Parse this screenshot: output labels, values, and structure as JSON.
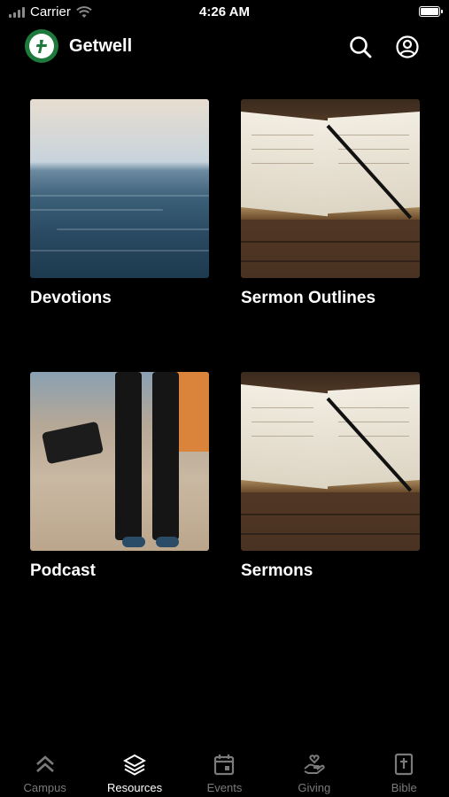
{
  "status_bar": {
    "carrier": "Carrier",
    "time": "4:26 AM"
  },
  "header": {
    "title": "Getwell"
  },
  "resources": [
    {
      "label": "Devotions"
    },
    {
      "label": "Sermon Outlines"
    },
    {
      "label": "Podcast"
    },
    {
      "label": "Sermons"
    }
  ],
  "tabs": [
    {
      "label": "Campus",
      "icon": "chevrons-up-icon"
    },
    {
      "label": "Resources",
      "icon": "stack-layers-icon",
      "active": true
    },
    {
      "label": "Events",
      "icon": "calendar-icon"
    },
    {
      "label": "Giving",
      "icon": "hand-heart-icon"
    },
    {
      "label": "Bible",
      "icon": "bible-icon"
    }
  ],
  "colors": {
    "background": "#000000",
    "logo": "#1e7a3c",
    "tab_inactive": "#7a7a7a",
    "tab_active": "#ffffff"
  }
}
